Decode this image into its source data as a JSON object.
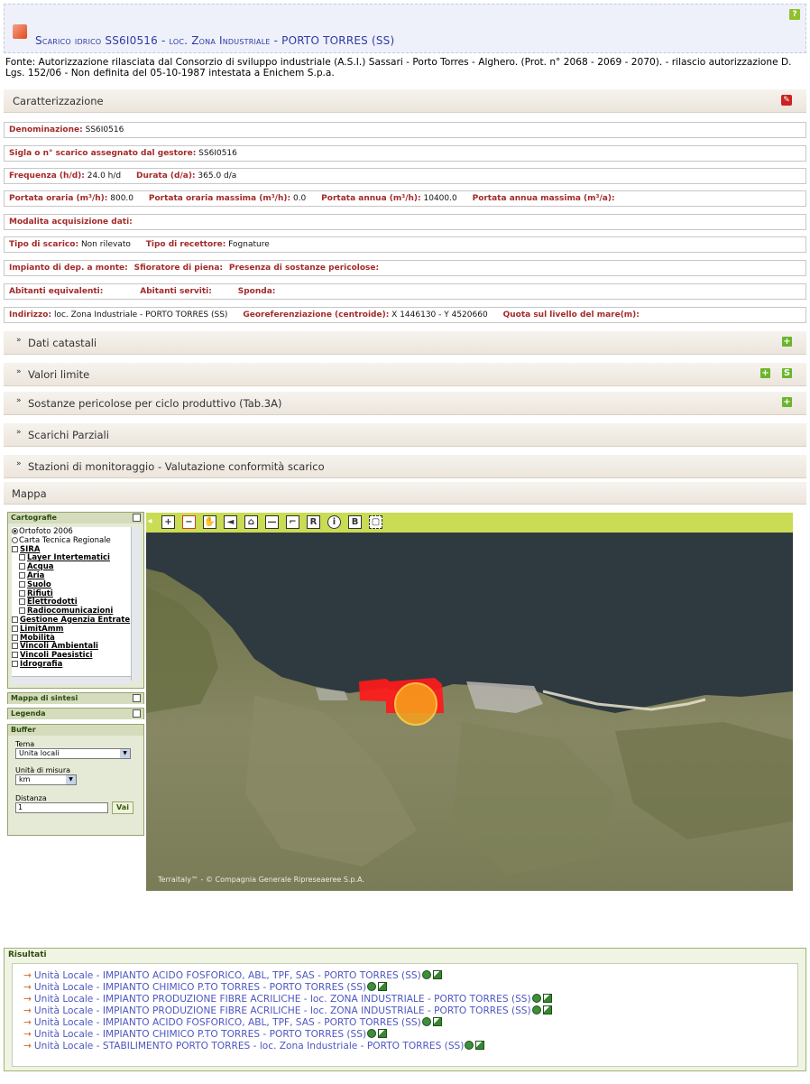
{
  "header": {
    "help_label": "?",
    "title": "Scarico idrico SS6I0516 - loc. Zona Industriale - PORTO TORRES (SS)"
  },
  "source_text": "Fonte: Autorizzazione rilasciata dal Consorzio di sviluppo industriale (A.S.I.) Sassari - Porto Torres - Alghero. (Prot. n° 2068 - 2069 - 2070). - rilascio autorizzazione D. Lgs. 152/06 - Non definita del 05-10-1987 intestata a Enichem S.p.a.",
  "caratterizzazione": {
    "title": "Caratterizzazione",
    "rows": {
      "denominazione": {
        "label": "Denominazione:",
        "value": "SS6I0516"
      },
      "sigla": {
        "label": "Sigla o n° scarico assegnato dal gestore:",
        "value": "SS6I0516"
      },
      "frequenza": {
        "label": "Frequenza (h/d):",
        "value": "24.0 h/d"
      },
      "durata": {
        "label": "Durata (d/a):",
        "value": "365.0 d/a"
      },
      "portata_oraria": {
        "label": "Portata oraria (m³/h):",
        "value": "800.0"
      },
      "portata_oraria_max": {
        "label": "Portata oraria massima (m³/h):",
        "value": "0.0"
      },
      "portata_annua": {
        "label": "Portata annua (m³/h):",
        "value": "10400.0"
      },
      "portata_annua_max": {
        "label": "Portata annua massima (m³/a):",
        "value": ""
      },
      "modalita": {
        "label": "Modalita acquisizione dati:",
        "value": ""
      },
      "tipo_scarico": {
        "label": "Tipo di scarico:",
        "value": "Non rilevato"
      },
      "tipo_recettore": {
        "label": "Tipo di recettore:",
        "value": "Fognature"
      },
      "impianto_dep": {
        "label": "Impianto di dep. a monte:",
        "value": ""
      },
      "sfioratore": {
        "label": "Sfioratore di piena:",
        "value": ""
      },
      "sostanze_pericolose": {
        "label": "Presenza di sostanze pericolose:",
        "value": ""
      },
      "abitanti_equivalenti": {
        "label": "Abitanti equivalenti:",
        "value": ""
      },
      "abitanti_serviti": {
        "label": "Abitanti serviti:",
        "value": ""
      },
      "sponda": {
        "label": "Sponda:",
        "value": ""
      },
      "indirizzo": {
        "label": "Indirizzo:",
        "value": "loc. Zona Industriale - PORTO TORRES (SS)"
      },
      "georef": {
        "label": "Georeferenziazione (centroide):",
        "value": "X 1446130 - Y 4520660"
      },
      "quota": {
        "label": "Quota sul livello del mare(m):",
        "value": ""
      }
    }
  },
  "sections": {
    "dati_catastali": "Dati catastali",
    "valori_limite": "Valori limite",
    "sostanze_tab3a": "Sostanze pericolose per ciclo produttivo (Tab.3A)",
    "scarichi_parziali": "Scarichi Parziali",
    "stazioni": "Stazioni di monitoraggio - Valutazione conformità scarico",
    "mappa": "Mappa"
  },
  "map_panel": {
    "cartografie": {
      "title": "Cartografie",
      "base_layers": [
        "Ortofoto 2006",
        "Carta Tecnica Regionale"
      ],
      "group_sira": "SIRA",
      "sira_layers": [
        "Layer Intertematici",
        "Acqua",
        "Aria",
        "Suolo",
        "Rifiuti",
        "Elettrodotti",
        "Radiocomunicazioni"
      ],
      "other_layers": [
        "Gestione Agenzia Entrate",
        "LimitAmm",
        "Mobilità",
        "Vincoli Ambientali",
        "Vincoli Paesistici",
        "Idrografia"
      ]
    },
    "mappa_di_sintesi": "Mappa di sintesi",
    "legenda": "Legenda",
    "buffer": {
      "title": "Buffer",
      "tema_label": "Tema",
      "tema_value": "Unita locali",
      "unita_label": "Unità di misura",
      "unita_value": "km",
      "distanza_label": "Distanza",
      "distanza_value": "1",
      "go_label": "Vai"
    },
    "toolbar": {
      "collapse": "◂",
      "zoom_in": "+",
      "zoom_out": "−",
      "pan": "✋",
      "back": "◄",
      "home": "⌂",
      "measure": "—",
      "area": "⌐",
      "r_label": "R",
      "info": "i",
      "b_label": "B",
      "select": "▢"
    },
    "copyright": "Terraitaly™ - © Compagnia Generale Ripreseaeree S.p.A."
  },
  "results": {
    "title": "Risultati",
    "items": [
      "Unità Locale - IMPIANTO ACIDO FOSFORICO, ABL, TPF, SAS - PORTO TORRES (SS)",
      "Unità Locale - IMPIANTO CHIMICO P.TO TORRES - PORTO TORRES (SS)",
      "Unità Locale - IMPIANTO PRODUZIONE FIBRE ACRILICHE - loc. ZONA INDUSTRIALE - PORTO TORRES (SS)",
      "Unità Locale - IMPIANTO PRODUZIONE FIBRE ACRILICHE - loc. ZONA INDUSTRIALE - PORTO TORRES (SS)",
      "Unità Locale - IMPIANTO ACIDO FOSFORICO, ABL, TPF, SAS - PORTO TORRES (SS)",
      "Unità Locale - IMPIANTO CHIMICO P.TO TORRES - PORTO TORRES (SS)",
      "Unità Locale - STABILIMENTO PORTO TORRES - loc. Zona Industriale - PORTO TORRES (SS)"
    ]
  },
  "colors": {
    "label_red": "#a42a2a",
    "link_blue": "#4d56c0",
    "toolbar_green": "#c9dc54",
    "highlight_red": "#ff1a1a",
    "buffer_circle": "#f7a21b"
  }
}
